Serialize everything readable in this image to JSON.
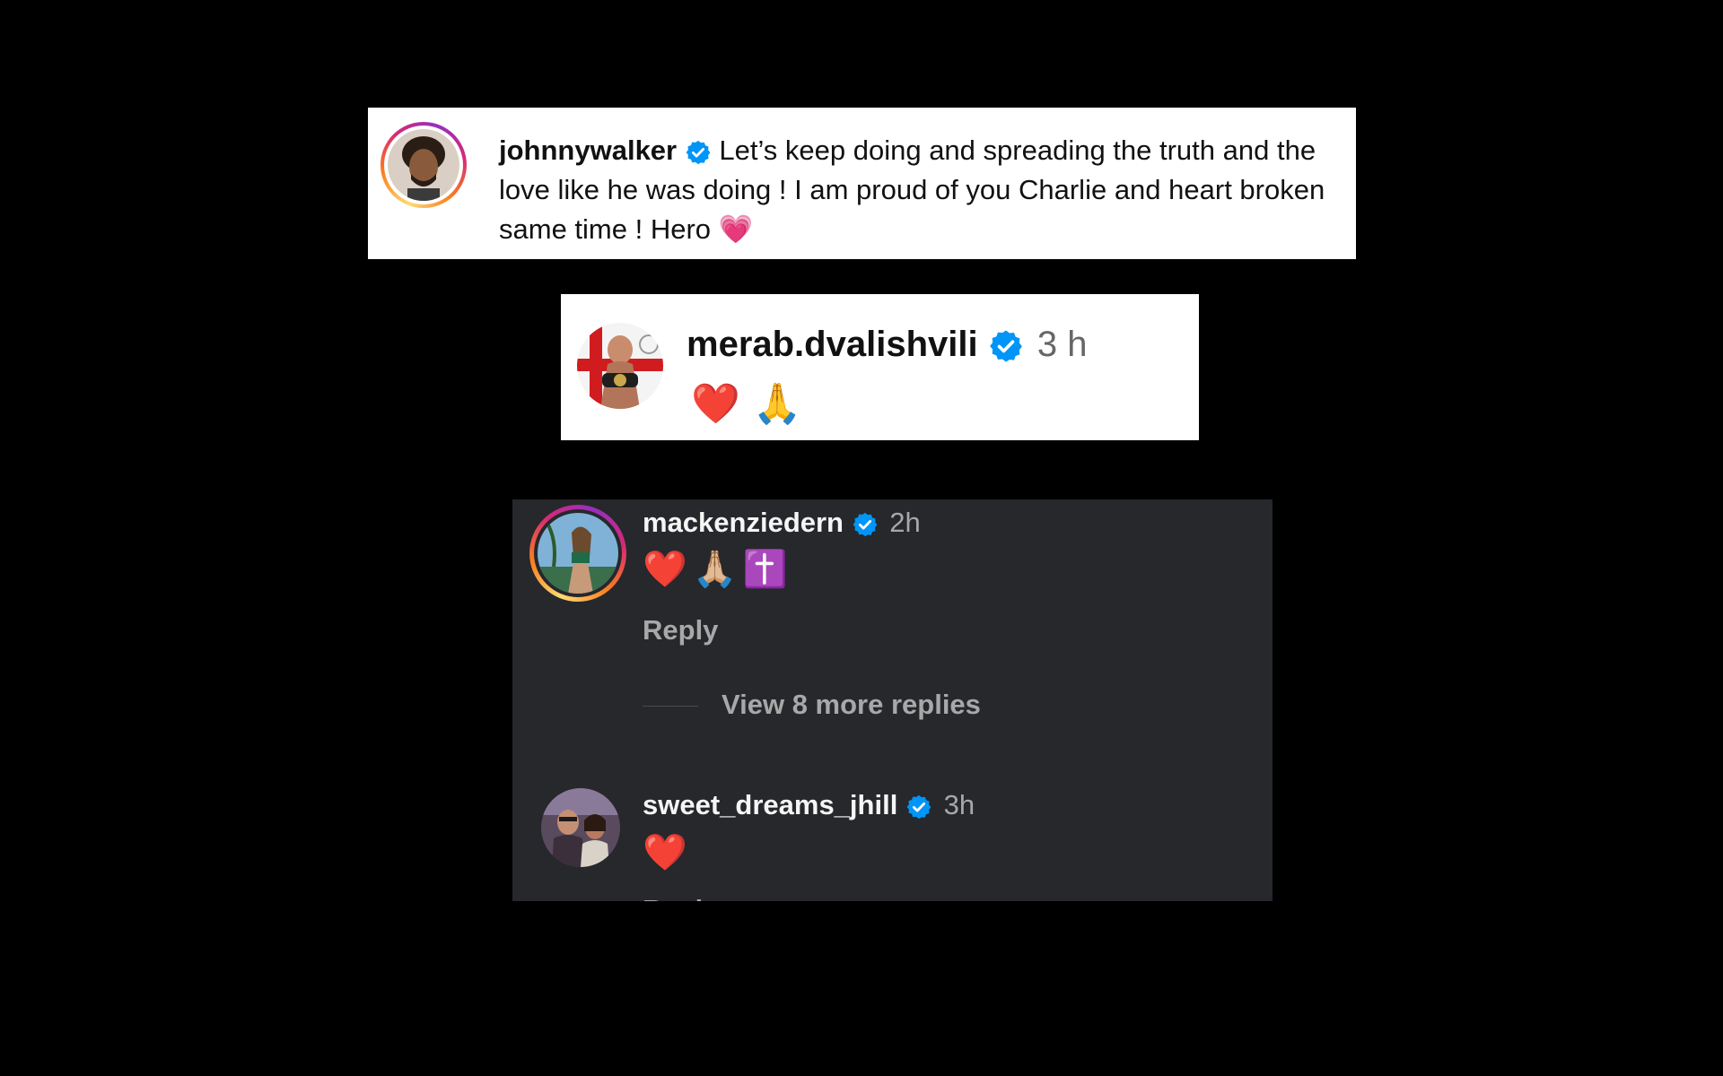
{
  "comments": [
    {
      "username": "johnnywalker",
      "verified": true,
      "text": "Let’s keep doing and spreading the truth and the love like he was doing ! I am proud of you Charlie and heart broken same time ! Hero",
      "emoji": "💗"
    },
    {
      "username": "merab.dvalishvili",
      "verified": true,
      "time": "3 h",
      "emoji": "❤️ 🙏"
    },
    {
      "username": "mackenziedern",
      "verified": true,
      "time": "2h",
      "emoji": "❤️🙏🏼✝️",
      "reply_label": "Reply",
      "view_replies_label": "View 8 more replies"
    },
    {
      "username": "sweet_dreams_jhill",
      "verified": true,
      "time": "3h",
      "emoji": "❤️",
      "reply_label": "Reply"
    }
  ],
  "colors": {
    "verified_blue": "#0095f6",
    "dark_panel": "#26282c"
  },
  "icons": [
    "verified-badge-icon"
  ]
}
